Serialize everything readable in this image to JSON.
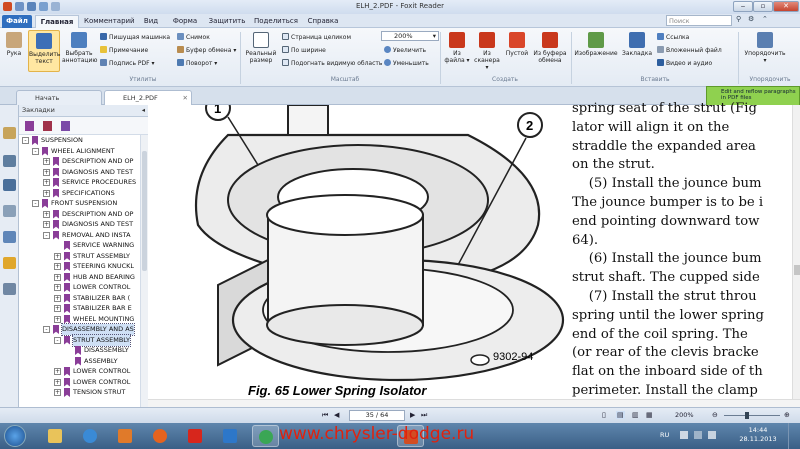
{
  "window": {
    "title": "ELH_2.PDF - Foxit Reader"
  },
  "ribbon_tabs": [
    "Файл",
    "Главная",
    "Комментарий",
    "Вид",
    "Форма",
    "Защитить",
    "Поделиться",
    "Справка"
  ],
  "search_placeholder": "Поиск",
  "ribbon": {
    "hand": "Рука",
    "select_text": "Выделить текст",
    "select_annotation": "Выбрать аннотацию",
    "typewriter": "Пишущая машинка",
    "note": "Примечание",
    "pdf_sign": "Подпись PDF",
    "snapshot": "Снимок",
    "clipboard": "Буфер обмена",
    "rotate": "Поворот",
    "actual_size": "Реальный размер",
    "fit_page": "Страница целиком",
    "fit_width": "По ширине",
    "fit_visible": "Подогнать видимую область",
    "zoom_value": "200%",
    "zoom_in": "Увеличить",
    "zoom_out": "Уменьшить",
    "from_file": "Из файла",
    "from_scanner": "Из сканера",
    "blank": "Пустой",
    "from_clipboard": "Из буфера обмена",
    "image": "Изображение",
    "bookmark": "Закладка",
    "link": "Ссылка",
    "attached_file": "Вложенный файл",
    "video_audio": "Видео и аудио",
    "arrange": "Упорядочить",
    "group_utilities": "Утилиты",
    "group_zoom": "Масштаб",
    "group_create": "Создать",
    "group_insert": "Вставить",
    "group_arrange": "Упорядочить"
  },
  "doc_tabs": [
    "Начать",
    "ELH_2.PDF"
  ],
  "tooltip": "Edit and reflow paragraphs in PDF files",
  "bookmarks_header": "Закладки",
  "bookmarks": [
    {
      "label": "SUSPENSION",
      "level": 0,
      "expand": "-"
    },
    {
      "label": "WHEEL ALIGNMENT",
      "level": 1,
      "expand": "-"
    },
    {
      "label": "DESCRIPTION AND OP",
      "level": 2,
      "expand": "+"
    },
    {
      "label": "DIAGNOSIS AND TEST",
      "level": 2,
      "expand": "+"
    },
    {
      "label": "SERVICE PROCEDURES",
      "level": 2,
      "expand": "+"
    },
    {
      "label": "SPECIFICATIONS",
      "level": 2,
      "expand": "+"
    },
    {
      "label": "FRONT SUSPENSION",
      "level": 1,
      "expand": "-"
    },
    {
      "label": "DESCRIPTION AND OP",
      "level": 2,
      "expand": "+"
    },
    {
      "label": "DIAGNOSIS AND TEST",
      "level": 2,
      "expand": "+"
    },
    {
      "label": "REMOVAL AND INSTA",
      "level": 2,
      "expand": "-"
    },
    {
      "label": "SERVICE WARNING",
      "level": 3,
      "expand": ""
    },
    {
      "label": "STRUT ASSEMBLY",
      "level": 3,
      "expand": "+"
    },
    {
      "label": "STEERING KNUCKL",
      "level": 3,
      "expand": "+"
    },
    {
      "label": "HUB AND BEARING",
      "level": 3,
      "expand": "+"
    },
    {
      "label": "LOWER CONTROL",
      "level": 3,
      "expand": "+"
    },
    {
      "label": "STABILIZER BAR (",
      "level": 3,
      "expand": "+"
    },
    {
      "label": "STABILIZER BAR E",
      "level": 3,
      "expand": "+"
    },
    {
      "label": "WHEEL MOUNTING",
      "level": 3,
      "expand": "+"
    },
    {
      "label": "DISASSEMBLY AND AS",
      "level": 2,
      "expand": "-",
      "selected": true
    },
    {
      "label": "STRUT ASSEMBLY",
      "level": 3,
      "expand": "-",
      "selected": true
    },
    {
      "label": "DISASSEMBLY",
      "level": 4,
      "expand": ""
    },
    {
      "label": "ASSEMBLY",
      "level": 4,
      "expand": ""
    },
    {
      "label": "LOWER CONTROL",
      "level": 3,
      "expand": "+"
    },
    {
      "label": "LOWER CONTROL",
      "level": 3,
      "expand": "+"
    },
    {
      "label": "TENSION STRUT",
      "level": 3,
      "expand": "+"
    }
  ],
  "figure": {
    "callout1": "1",
    "callout2": "2",
    "figure_number": "9302-94",
    "caption": "Fig. 65 Lower Spring Isolator"
  },
  "doc_text": [
    "spring seat of the strut (Fig",
    "lator will align it on the",
    "straddle the expanded area",
    "on the strut.",
    "    (5) Install the jounce bum",
    "The jounce bumper is to be i",
    "end pointing downward tow",
    "64).",
    "    (6) Install the jounce bum",
    "strut shaft. The cupped side",
    "    (7) Install the strut throu",
    "spring until the lower spring",
    "end of the coil spring. The",
    "(or rear of the clevis bracke",
    "flat on the inboard side of th",
    "perimeter. Install the clamp"
  ],
  "status": {
    "page": "35 / 64",
    "zoom": "200%"
  },
  "taskbar": {
    "watermark": "www.chrysler-dodge.ru",
    "lang": "RU",
    "time": "14:44",
    "date": "28.11.2013"
  },
  "colors": {
    "file_tab": "#2f6ebf",
    "bookmark_icon": "#8a3d98",
    "watermark": "#e0220e",
    "tooltip": "#8fd14f"
  }
}
